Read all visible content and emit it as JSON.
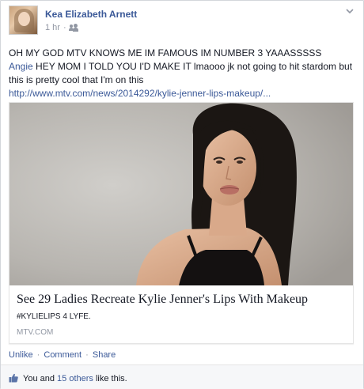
{
  "post": {
    "author": "Kea Elizabeth Arnett",
    "time": "1 hr",
    "separator": "·",
    "message_line1": "OH MY GOD MTV KNOWS ME IM FAMOUS IM NUMBER 3 YAAASSSSS",
    "tagged_name": "Angie",
    "message_line2": " HEY MOM I TOLD YOU I'D MAKE IT lmaooo jk not going to hit stardom but this is pretty cool that I'm on this",
    "link_url": "http://www.mtv.com/news/2014292/kylie-jenner-lips-makeup/..."
  },
  "attachment": {
    "title": "See 29 Ladies Recreate Kylie Jenner's Lips With Makeup",
    "description": "#KYLIELIPS 4 LYFE.",
    "source": "MTV.COM"
  },
  "actions": {
    "unlike": "Unlike",
    "comment": "Comment",
    "share": "Share",
    "dot": "·"
  },
  "likes": {
    "prefix": "You and ",
    "others": "15 others",
    "suffix": " like this."
  },
  "colors": {
    "link": "#3b5998",
    "text": "#141823",
    "meta": "#9197a3"
  }
}
